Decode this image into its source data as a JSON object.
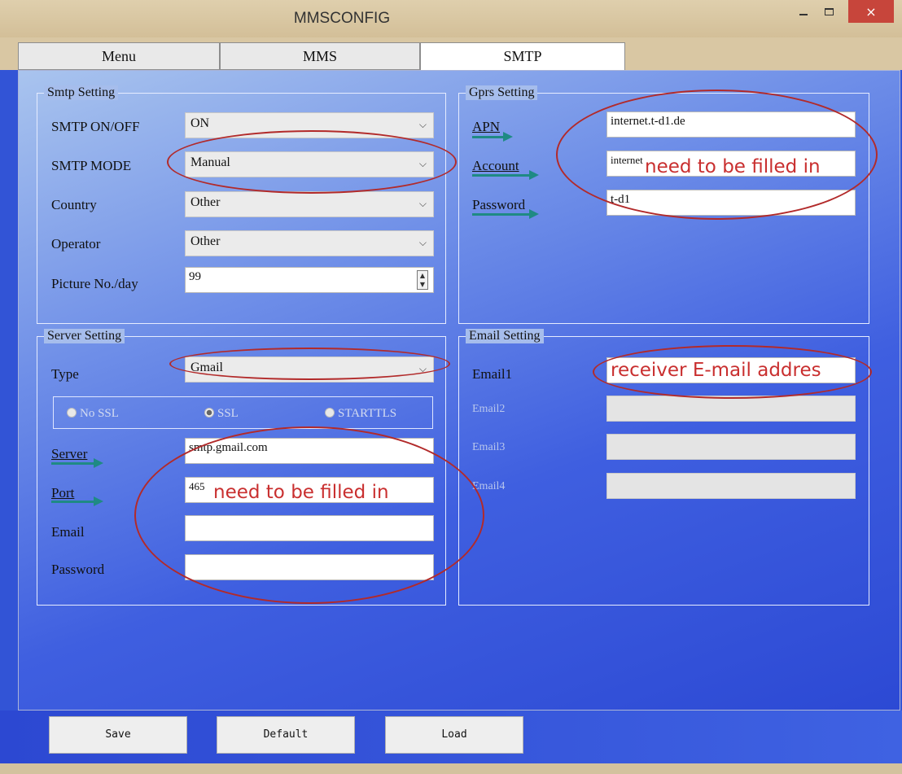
{
  "window": {
    "title": "MMSCONFIG",
    "close_glyph": "×"
  },
  "tabs": [
    {
      "label": "Menu",
      "active": false
    },
    {
      "label": "MMS",
      "active": false
    },
    {
      "label": "SMTP",
      "active": true
    }
  ],
  "smtp_setting": {
    "title": "Smtp Setting",
    "on_off_label": "SMTP ON/OFF",
    "on_off_value": "ON",
    "mode_label": "SMTP MODE",
    "mode_value": "Manual",
    "country_label": "Country",
    "country_value": "Other",
    "operator_label": "Operator",
    "operator_value": "Other",
    "picture_label": "Picture No./day",
    "picture_value": "99"
  },
  "gprs_setting": {
    "title": "Gprs Setting",
    "apn_label": "APN",
    "apn_value": "internet.t-d1.de",
    "account_label": "Account",
    "account_value": "internet",
    "password_label": "Password",
    "password_value": "t-d1"
  },
  "server_setting": {
    "title": "Server Setting",
    "type_label": "Type",
    "type_value": "Gmail",
    "ssl_options": [
      "No SSL",
      "SSL",
      "STARTTLS"
    ],
    "ssl_selected": "SSL",
    "server_label": "Server",
    "server_value": "smtp.gmail.com",
    "port_label": "Port",
    "port_value": "465",
    "email_label": "Email",
    "email_value": "",
    "password_label": "Password",
    "password_value": ""
  },
  "email_setting": {
    "title": "Email Setting",
    "email1_label": "Email1",
    "email1_value": "",
    "email2_label": "Email2",
    "email3_label": "Email3",
    "email4_label": "Email4"
  },
  "annotations": {
    "gprs_note": "need to be filled in",
    "server_note": "need to be filled in",
    "email_note": "receiver E-mail addres"
  },
  "buttons": {
    "save": "Save",
    "default": "Default",
    "load": "Load"
  },
  "icons": {
    "dropdown": "chevron-down-icon",
    "spinner": "spinner-icon"
  },
  "colors": {
    "annotation": "#c92f2f",
    "arrow": "#1f8a84",
    "close": "#c7453b"
  }
}
